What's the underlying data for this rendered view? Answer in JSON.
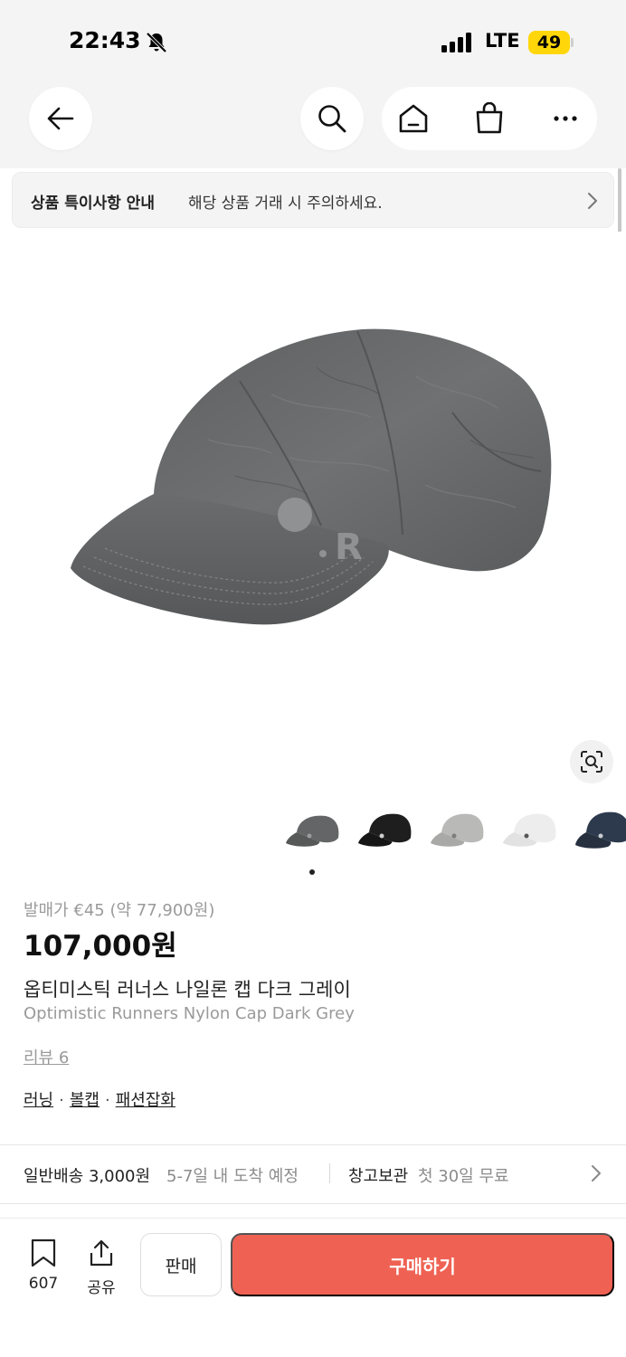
{
  "status_bar": {
    "time": "22:43",
    "network": "LTE",
    "battery": "49"
  },
  "notice": {
    "bold": "상품 특이사항 안내",
    "text": "해당 상품 거래 시 주의하세요."
  },
  "product": {
    "release_price": "발매가 €45 (약 77,900원)",
    "price": "107,000원",
    "name_ko": "옵티미스틱 러너스 나일론 캡 다크 그레이",
    "name_en": "Optimistic Runners Nylon Cap Dark Grey",
    "review": "리뷰 6",
    "tags": [
      "러닝",
      "볼캡",
      "패션잡화"
    ],
    "tag_separator": "·",
    "logo_letter": "R"
  },
  "shipping": {
    "standard_label": "일반배송 3,000원",
    "standard_eta": "5-7일 내 도착 예정",
    "storage_label": "창고보관",
    "storage_offer": "첫 30일 무료"
  },
  "bottom_bar": {
    "bookmark_count": "607",
    "share_label": "공유",
    "sell_label": "판매",
    "buy_label": "구매하기"
  },
  "colors": {
    "buy_button": "#ef6253",
    "cap_dark_grey": "#6b6d6e",
    "battery_badge": "#ffd60a"
  },
  "icons": [
    "back-arrow-icon",
    "search-icon",
    "home-icon",
    "shopping-bag-icon",
    "more-icon",
    "chevron-right-icon",
    "lens-search-icon",
    "bookmark-icon",
    "share-icon",
    "bell-off-icon"
  ]
}
